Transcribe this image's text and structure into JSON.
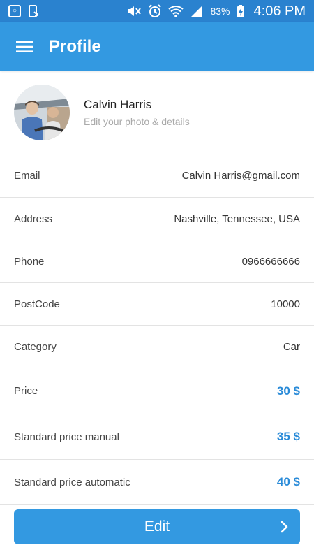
{
  "status_bar": {
    "battery_percent": "83%",
    "time": "4:06 PM",
    "icons": [
      "notification-icon",
      "phone-download-icon",
      "mute-icon",
      "alarm-icon",
      "wifi-icon",
      "signal-icon",
      "battery-charging-icon"
    ]
  },
  "app_bar": {
    "title": "Profile",
    "menu_icon": "hamburger-icon"
  },
  "profile": {
    "name": "Calvin Harris",
    "subtitle": "Edit your photo & details"
  },
  "details": [
    {
      "label": "Email",
      "value": "Calvin Harris@gmail.com"
    },
    {
      "label": "Address",
      "value": "Nashville, Tennessee, USA"
    },
    {
      "label": "Phone",
      "value": "0966666666"
    },
    {
      "label": "PostCode",
      "value": "10000"
    },
    {
      "label": "Category",
      "value": "Car"
    }
  ],
  "prices": [
    {
      "label": "Price",
      "value": "30 $"
    },
    {
      "label": "Standard price manual",
      "value": "35 $"
    },
    {
      "label": "Standard price automatic",
      "value": "40 $"
    }
  ],
  "edit_button": {
    "label": "Edit",
    "icon": "chevron-right-icon"
  },
  "colors": {
    "status_bar": "#2a82cf",
    "app_bar": "#3399e1",
    "price": "#2a8bd8",
    "button": "#3399e1"
  }
}
